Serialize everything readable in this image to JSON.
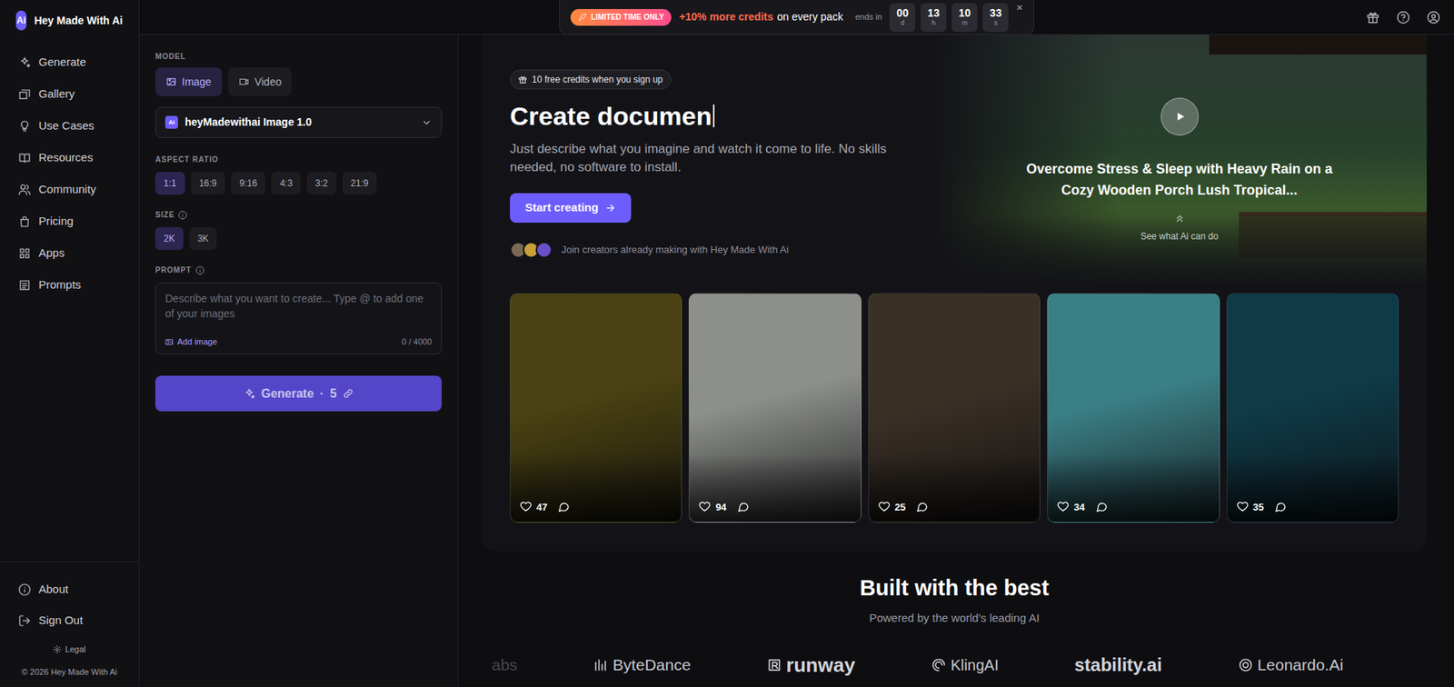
{
  "brand": {
    "logo": "Ai",
    "name": "Hey Made With Ai"
  },
  "nav": [
    "Generate",
    "Gallery",
    "Use Cases",
    "Resources",
    "Community",
    "Pricing",
    "Apps",
    "Prompts"
  ],
  "footer_nav": [
    "About",
    "Sign Out"
  ],
  "legal": "Legal",
  "copyright": "© 2026 Hey Made With Ai",
  "promo": {
    "badge": "LIMITED TIME ONLY",
    "highlight": "+10% more credits",
    "text": "on every pack",
    "ends": "ends in",
    "countdown": [
      {
        "value": "00",
        "unit": "d"
      },
      {
        "value": "13",
        "unit": "h"
      },
      {
        "value": "10",
        "unit": "m"
      },
      {
        "value": "33",
        "unit": "s"
      }
    ],
    "close": "×"
  },
  "model": {
    "label": "MODEL",
    "tabs": [
      {
        "label": "Image",
        "selected": true
      },
      {
        "label": "Video",
        "selected": false
      }
    ],
    "select": {
      "logo": "Ai",
      "value": "heyMadewithai Image 1.0"
    }
  },
  "aspect": {
    "label": "ASPECT RATIO",
    "options": [
      {
        "label": "1:1",
        "selected": true
      },
      {
        "label": "16:9",
        "selected": false
      },
      {
        "label": "9:16",
        "selected": false
      },
      {
        "label": "4:3",
        "selected": false
      },
      {
        "label": "3:2",
        "selected": false
      },
      {
        "label": "21:9",
        "selected": false
      }
    ]
  },
  "size": {
    "label": "SIZE",
    "options": [
      {
        "label": "2K",
        "selected": true
      },
      {
        "label": "3K",
        "selected": false
      }
    ]
  },
  "prompt": {
    "label": "PROMPT",
    "placeholder": "Describe what you want to create... Type @ to add one of your images",
    "add_image": "Add image",
    "counter": "0 / 4000"
  },
  "generate": {
    "label": "Generate",
    "separator": "·",
    "cost": "5",
    "disabled": true
  },
  "hero": {
    "pill": "10 free credits when you sign up",
    "heading": "Create documen",
    "paragraph": "Just describe what you imagine and watch it come to life. No skills needed, no software to install.",
    "cta": "Start creating",
    "social": "Join creators already making with Hey Made With Ai"
  },
  "video": {
    "caption": "Overcome Stress & Sleep with Heavy Rain on a Cozy Wooden Porch Lush Tropical...",
    "hint": "See what Ai can do"
  },
  "gallery": [
    {
      "likes": "47",
      "color": "#4a4212"
    },
    {
      "likes": "94",
      "color": "#8c8f8a"
    },
    {
      "likes": "25",
      "color": "#3a3026"
    },
    {
      "likes": "34",
      "color": "#3b7f86"
    },
    {
      "likes": "35",
      "color": "#0f3a48"
    }
  ],
  "partners": {
    "title": "Built with the best",
    "subtitle": "Powered by the world's leading AI",
    "logos": [
      "abs",
      "ByteDance",
      "runway",
      "KlingAI",
      "stability.ai",
      "Leonardo.Ai"
    ]
  }
}
